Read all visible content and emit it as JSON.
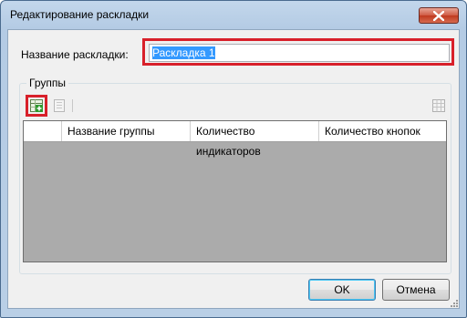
{
  "window": {
    "title": "Редактирование раскладки"
  },
  "name_field": {
    "label": "Название раскладки:",
    "value": "Раскладка 1"
  },
  "groups": {
    "label": "Группы",
    "columns": [
      "",
      "Название группы",
      "Количество индикаторов",
      "Количество кнопок"
    ]
  },
  "buttons": {
    "ok": "OK",
    "cancel": "Отмена"
  },
  "colors": {
    "highlight": "#d8202a",
    "grid_bg": "#ababab",
    "selection": "#3399ff"
  }
}
